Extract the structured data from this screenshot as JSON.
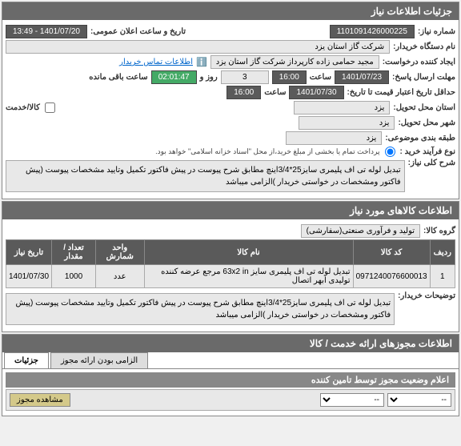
{
  "panel1": {
    "title": "جزئیات اطلاعات نیاز",
    "need_no_label": "شماره نیاز:",
    "need_no": "1101091426000225",
    "announce_label": "تاریخ و ساعت اعلان عمومی:",
    "announce_value": "1401/07/20 - 13:49",
    "buyer_label": "نام دستگاه خریدار:",
    "buyer_value": "شرکت گاز استان یزد",
    "creator_label": "ایجاد کننده درخواست:",
    "creator_value": "مجید حمامی زاده کارپرداز شرکت گاز استان یزد",
    "contact_link": "اطلاعات تماس خریدار",
    "deadline_label": "مهلت ارسال پاسخ:",
    "deadline_date": "1401/07/23",
    "time_label": "ساعت",
    "deadline_time": "16:00",
    "day_label": "روز و",
    "days_left": "3",
    "remain_time": "02:01:47",
    "remain_label": "ساعت باقی مانده",
    "validity_label": "حداقل تاریخ اعتبار قیمت تا تاریخ:",
    "validity_date": "1401/07/30",
    "validity_time": "16:00",
    "province_label": "استان محل تحویل:",
    "province": "یزد",
    "service_label": "کالا/خدمت",
    "city_label": "شهر محل تحویل:",
    "city": "یزد",
    "budget_label": "طبقه بندی موضوعی:",
    "budget": "یزد",
    "purchase_type_label": "نوع فرآیند خرید :",
    "payment_note": "پرداخت تمام یا بخشی از مبلغ خرید،از محل \"اسناد خزانه اسلامی\" خواهد بود.",
    "desc_label": "شرح کلی نیاز:",
    "desc_text": "تبدیل لوله تی اف پلیمری سایز25*3/4اینچ مطابق شرح پیوست در پیش فاکتور تکمیل وتایید مشخصات پیوست (پیش فاکتور ومشخصات در خواستی خریدار )الزامی میباشد"
  },
  "panel2": {
    "title": "اطلاعات کالاهای مورد نیاز",
    "group_label": "گروه کالا:",
    "group_value": "تولید و فرآوری صنعتی(سفارشی)",
    "cols": {
      "row": "ردیف",
      "code": "کد کالا",
      "name": "نام کالا",
      "unit": "واحد شمارش",
      "qty": "تعداد / مقدار",
      "date": "تاریخ نیاز"
    },
    "item": {
      "row": "1",
      "code": "0971240076600013",
      "name": "تبدیل لوله تی اف پلیمری سایز 63x2 in مرجع عرضه کننده تولیدی ابهر اتصال",
      "unit": "عدد",
      "qty": "1000",
      "date": "1401/07/30"
    },
    "buyer_notes_label": "توضیحات خریدار:",
    "buyer_notes": "تبدیل لوله تی اف پلیمری سایز25*3/4اینچ مطابق شرح پیوست در پیش فاکتور تکمیل وتایید مشخصات پیوست (پیش فاکتور ومشخصات در خواستی خریدار )الزامی میباشد"
  },
  "panel3": {
    "title": "اطلاعات مجوزهای ارائه خدمت / کالا",
    "tabs": {
      "details": "جزئیات",
      "mandatory": "الزامی بودن ارائه مجوز"
    },
    "status_header": "اعلام وضعیت مجوز توسط تامین کننده",
    "select_placeholder": "--",
    "view_btn": "مشاهده مجوز"
  }
}
